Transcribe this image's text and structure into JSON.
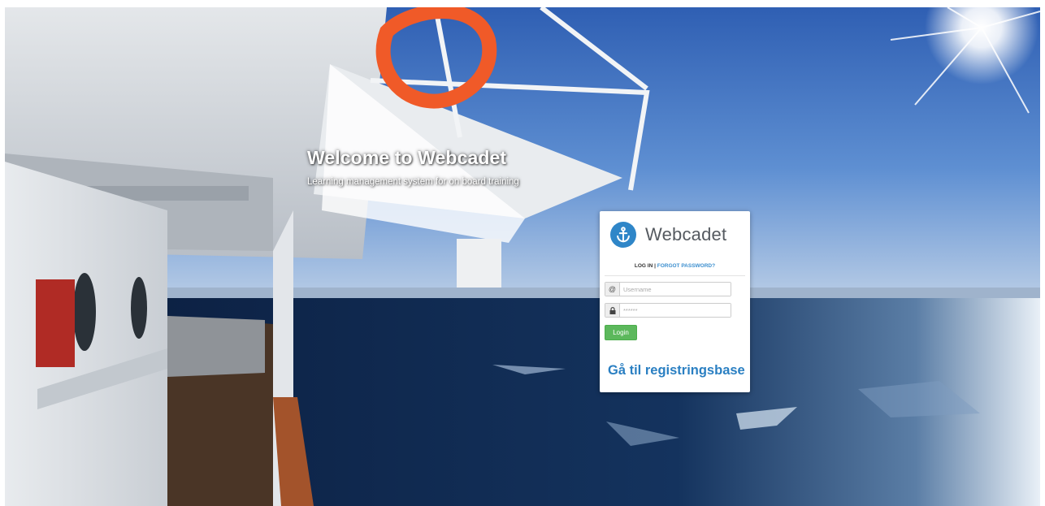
{
  "hero": {
    "title": "Welcome to Webcadet",
    "subtitle": "Learning management system for on board training"
  },
  "login": {
    "brand": "Webcadet",
    "login_label": "LOG IN",
    "separator": "|",
    "forgot_label": "FORGOT PASSWORD?",
    "username_icon": "@",
    "username_placeholder": "Username",
    "password_placeholder": "******",
    "button_label": "Login",
    "register_link": "Gå til registringsbase"
  },
  "colors": {
    "brand_blue": "#2f86c8",
    "link_blue": "#2a7fc2",
    "button_green": "#5cb85c"
  },
  "icons": {
    "logo": "anchor-icon",
    "username": "at-sign-icon",
    "password": "lock-icon"
  }
}
